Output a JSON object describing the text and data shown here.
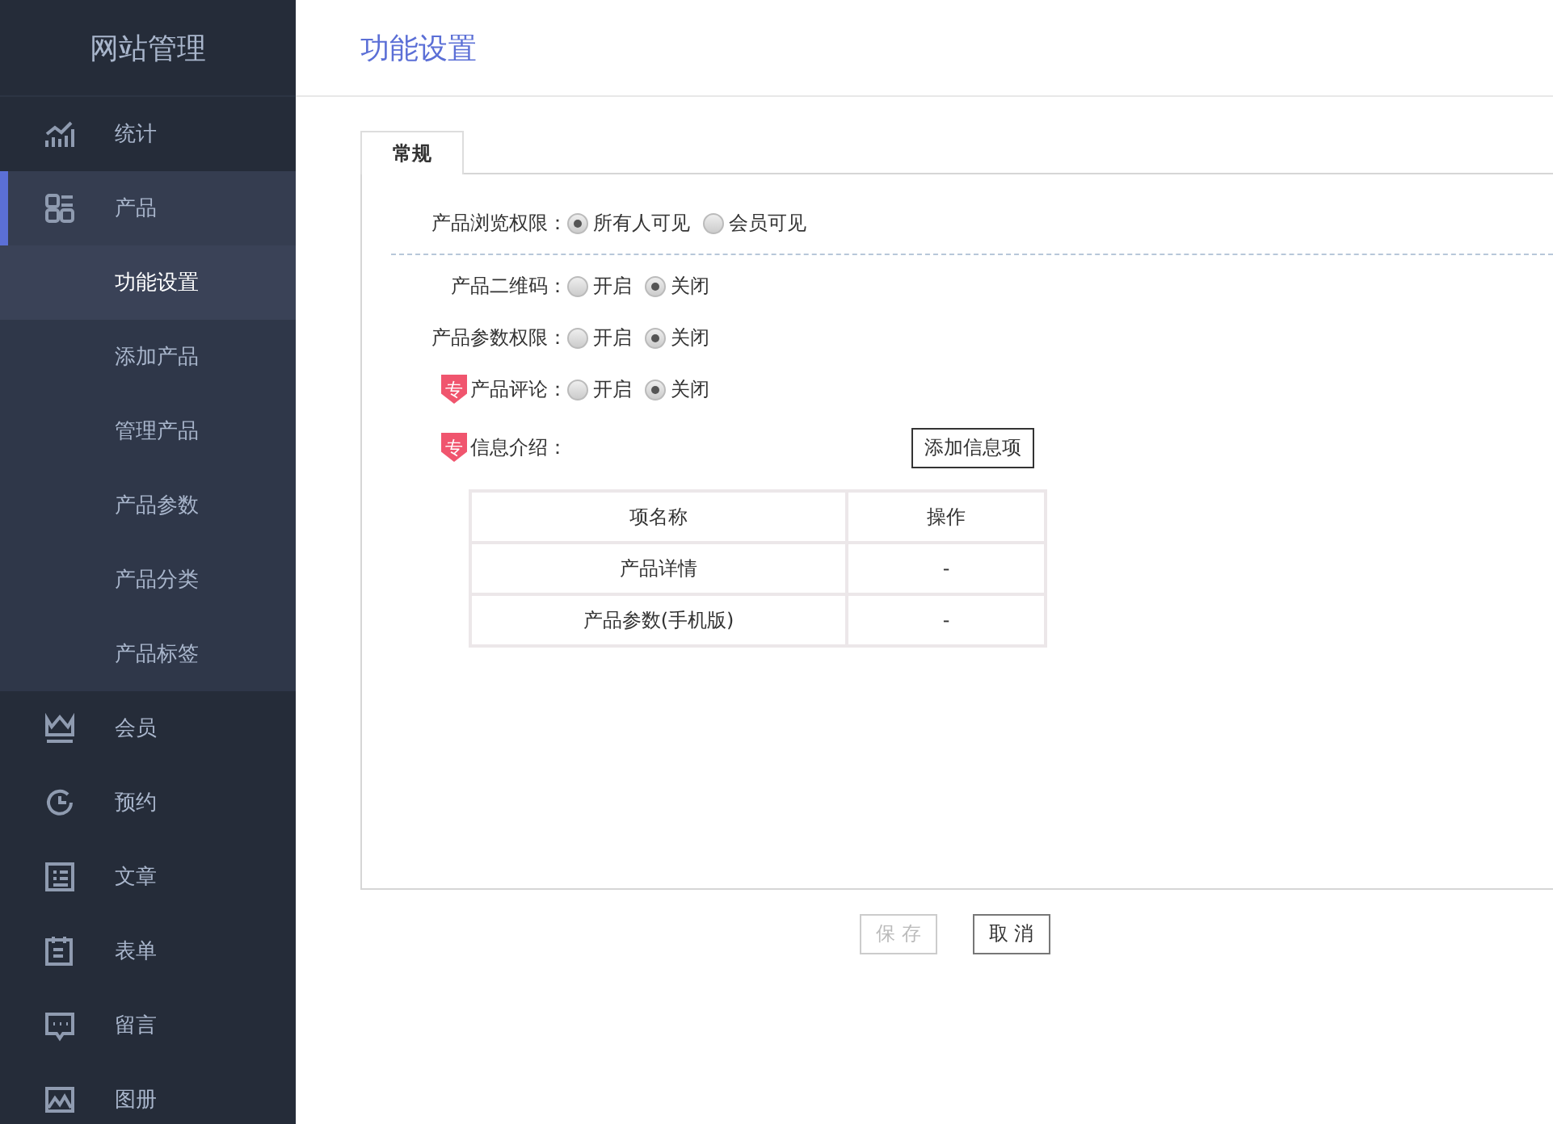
{
  "sidebar": {
    "title": "网站管理",
    "items": [
      {
        "label": "统计",
        "selected": false
      },
      {
        "label": "产品",
        "selected": true,
        "expanded": true,
        "children": [
          {
            "label": "功能设置",
            "selected": true
          },
          {
            "label": "添加产品",
            "selected": false
          },
          {
            "label": "管理产品",
            "selected": false
          },
          {
            "label": "产品参数",
            "selected": false
          },
          {
            "label": "产品分类",
            "selected": false
          },
          {
            "label": "产品标签",
            "selected": false
          }
        ]
      },
      {
        "label": "会员",
        "selected": false
      },
      {
        "label": "预约",
        "selected": false
      },
      {
        "label": "文章",
        "selected": false
      },
      {
        "label": "表单",
        "selected": false
      },
      {
        "label": "留言",
        "selected": false
      },
      {
        "label": "图册",
        "selected": false
      }
    ]
  },
  "page_title": "功能设置",
  "tabs": [
    {
      "label": "常规",
      "selected": true
    }
  ],
  "settings": [
    {
      "label": "产品浏览权限：",
      "options": [
        {
          "label": "所有人可见",
          "selected": true
        },
        {
          "label": "会员可见",
          "selected": false
        }
      ],
      "divider": true
    },
    {
      "label": "产品二维码：",
      "options": [
        {
          "label": "开启",
          "selected": false
        },
        {
          "label": "关闭",
          "selected": true
        }
      ]
    },
    {
      "label": "产品参数权限：",
      "options": [
        {
          "label": "开启",
          "selected": false
        },
        {
          "label": "关闭",
          "selected": true
        }
      ]
    },
    {
      "badge": "专",
      "label": "产品评论：",
      "options": [
        {
          "label": "开启",
          "selected": false
        },
        {
          "label": "关闭",
          "selected": true
        }
      ]
    }
  ],
  "info": {
    "badge": "专",
    "label": "信息介绍：",
    "add_button": "添加信息项",
    "table": {
      "columns": [
        "项名称",
        "操作"
      ],
      "rows": [
        [
          "产品详情",
          "-"
        ],
        [
          "产品参数(手机版)",
          "-"
        ]
      ]
    }
  },
  "buttons": [
    {
      "label": "保 存",
      "disabled": true
    },
    {
      "label": "取 消",
      "disabled": false
    }
  ]
}
